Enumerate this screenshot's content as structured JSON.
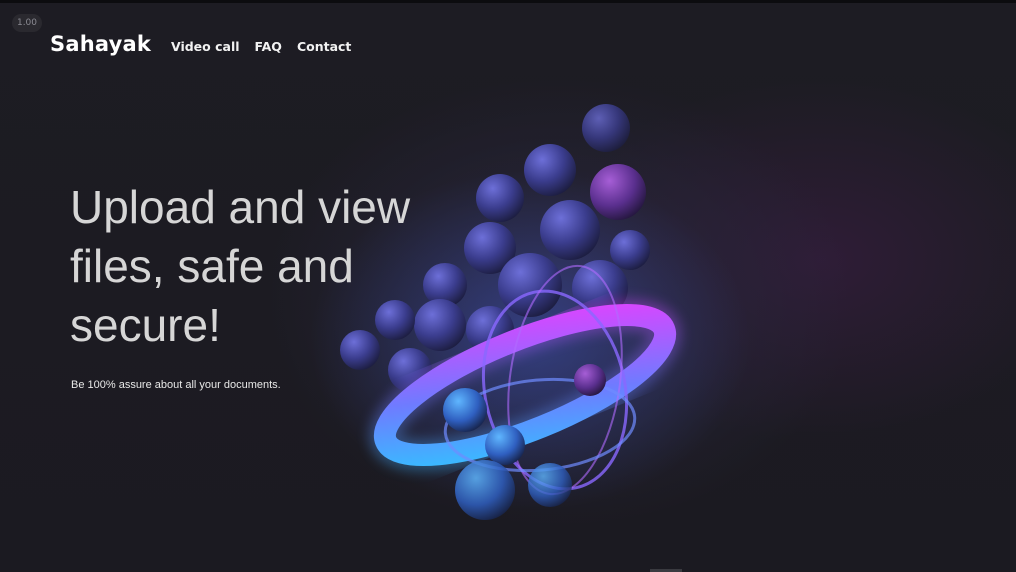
{
  "zoom_badge": "1.00",
  "nav": {
    "brand": "Sahayak",
    "links": [
      "Video call",
      "FAQ",
      "Contact"
    ]
  },
  "hero": {
    "headline": "Upload and view files, safe and secure!",
    "subtext": "Be 100% assure about all your documents."
  },
  "art": {
    "description_icon": "abstract-spheres-ring-icon",
    "colors": {
      "ring_start": "#2fb8ff",
      "ring_end": "#e23cff",
      "sphere": "#5a62c8",
      "background": "#1c1b22"
    }
  }
}
